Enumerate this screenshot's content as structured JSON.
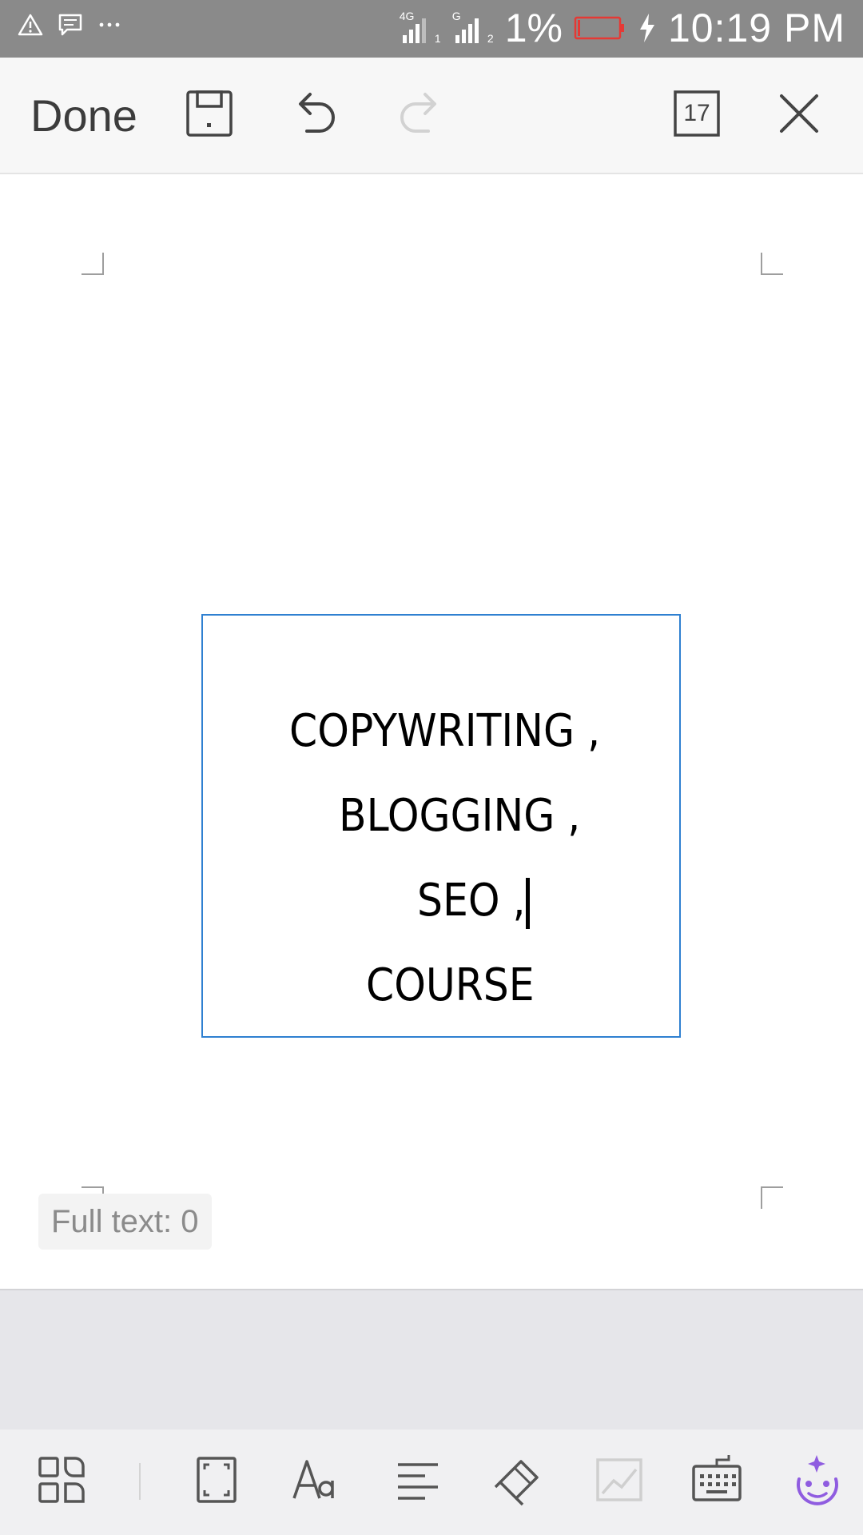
{
  "status_bar": {
    "time": "10:19 PM",
    "battery_percent": "1%",
    "network_1": "4G",
    "network_1_slot": "1",
    "network_2": "G",
    "network_2_slot": "2",
    "icons": [
      "warning-icon",
      "message-icon",
      "more-icon",
      "signal-icon",
      "battery-low-icon",
      "charging-icon"
    ]
  },
  "toolbar": {
    "done_label": "Done",
    "page_count": "17",
    "icons": [
      "save-icon",
      "undo-icon",
      "redo-icon",
      "page-count-icon",
      "close-icon"
    ]
  },
  "document": {
    "lines": [
      "COPYWRITING ,",
      "BLOGGING ,",
      "SEO ,",
      "COURSE"
    ],
    "full_text_label": "Full text: 0"
  },
  "bottom_toolbar": {
    "icons": [
      "apps-icon",
      "fullscreen-icon",
      "font-icon",
      "align-left-icon",
      "paint-brush-icon",
      "chart-icon",
      "keyboard-icon",
      "assistant-icon"
    ],
    "accent_color": "#8f5ce0"
  },
  "colors": {
    "status_bar": "#8a8a8a",
    "selection_border": "#2f80d1",
    "battery_low": "#e53935"
  }
}
